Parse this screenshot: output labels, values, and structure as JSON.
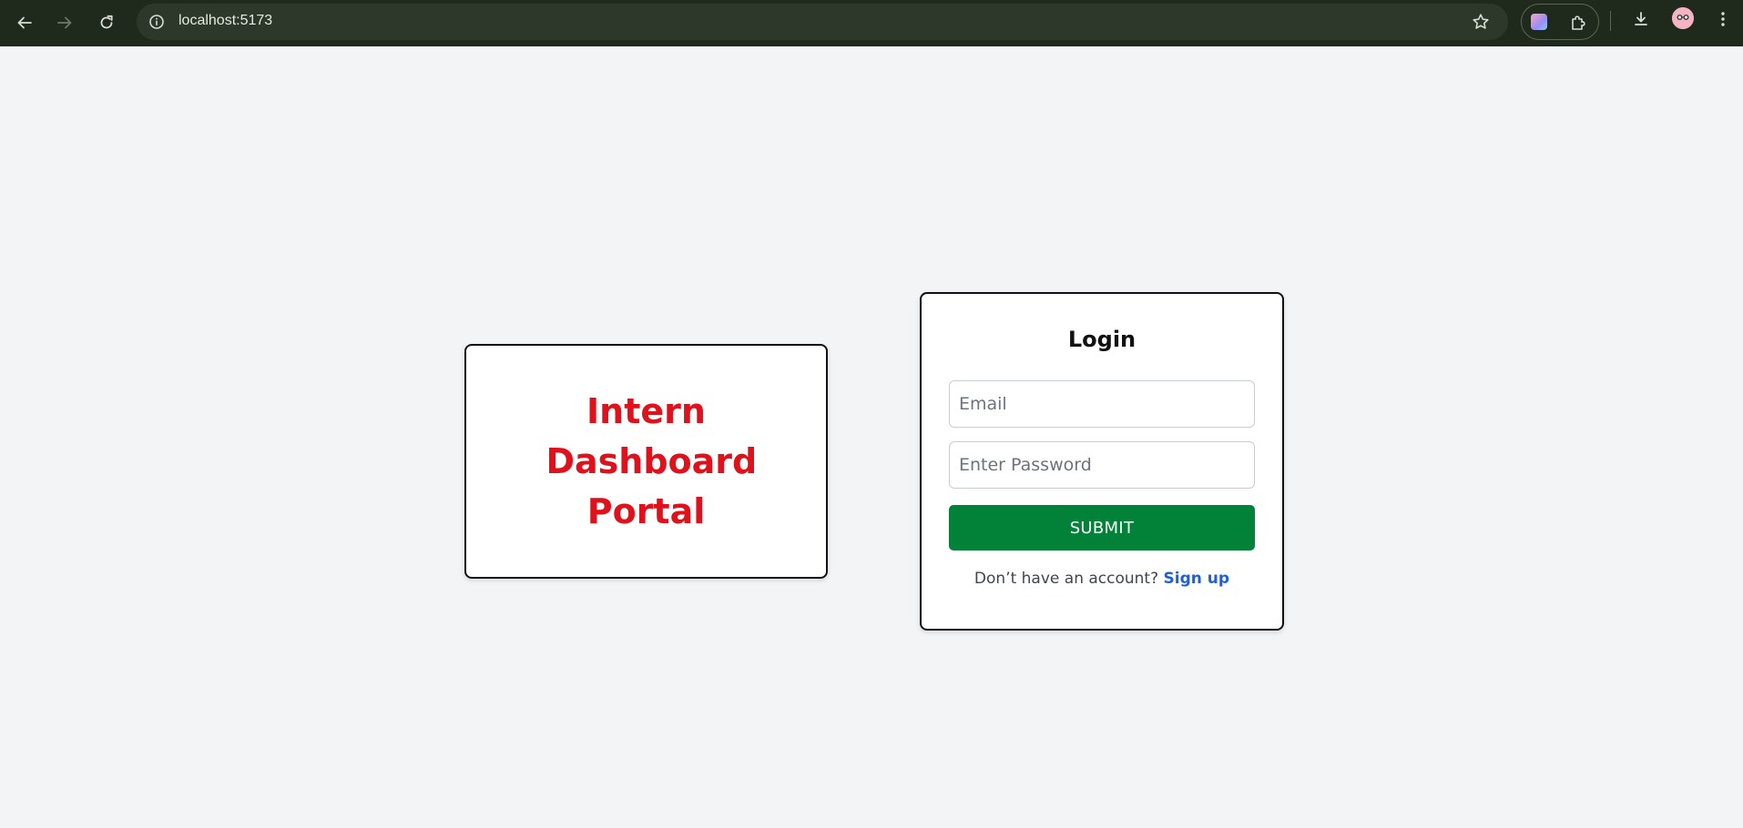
{
  "browser": {
    "url": "localhost:5173",
    "icons": {
      "back": "arrow-left-icon",
      "forward": "arrow-right-icon",
      "reload": "reload-icon",
      "site_info": "info-icon",
      "bookmark": "star-icon",
      "extension_app": "extension-app-icon",
      "extensions": "puzzle-icon",
      "downloads": "download-icon",
      "profile": "avatar",
      "menu": "kebab-menu-icon"
    }
  },
  "brand": {
    "title_line1": "Intern",
    "title_line2": "Dashboard",
    "title_line3": "Portal",
    "color": "#e0111b"
  },
  "login": {
    "title": "Login",
    "email_placeholder": "Email",
    "password_placeholder": "Enter Password",
    "submit_label": "SUBMIT",
    "submit_color": "#028238",
    "signup_prompt": "Don’t have an account?",
    "signup_link": "Sign up",
    "link_color": "#1d5fe0"
  },
  "colors": {
    "page_background": "#f3f4f6",
    "chrome_background": "#1f2a1c"
  }
}
